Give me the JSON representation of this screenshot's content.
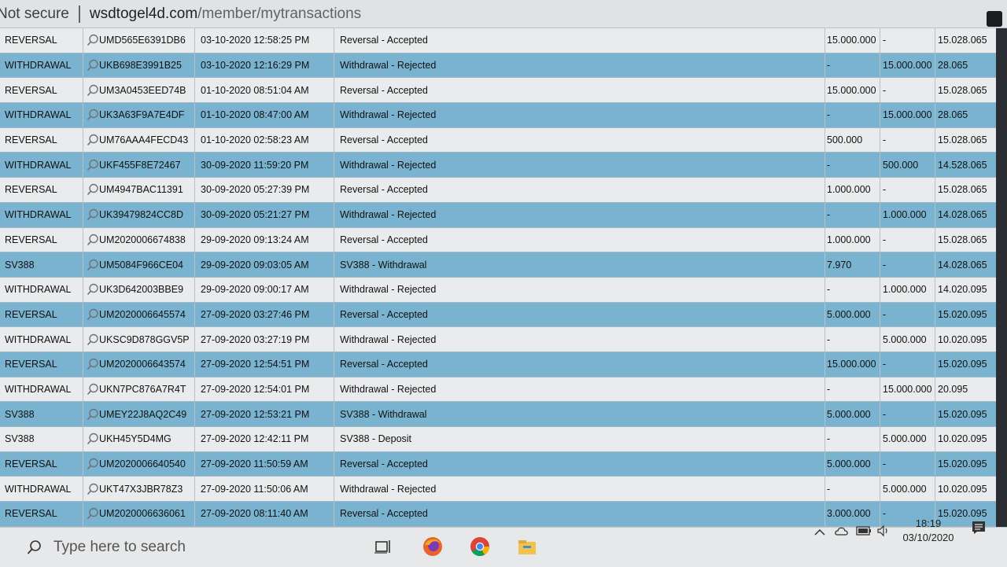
{
  "address_bar": {
    "security_label": "Not secure",
    "url_host": "wsdtogel4d.com",
    "url_path": "/member/mytransactions"
  },
  "transactions": [
    {
      "type": "REVERSAL",
      "id": "UMD565E6391DB6",
      "date": "03-10-2020 12:58:25 PM",
      "desc": "Reversal - Accepted",
      "debit": "15.000.000",
      "credit": "-",
      "balance": "15.028.065"
    },
    {
      "type": "WITHDRAWAL",
      "id": "UKB698E3991B25",
      "date": "03-10-2020 12:16:29 PM",
      "desc": "Withdrawal - Rejected",
      "debit": "-",
      "credit": "15.000.000",
      "balance": "28.065"
    },
    {
      "type": "REVERSAL",
      "id": "UM3A0453EED74B",
      "date": "01-10-2020 08:51:04 AM",
      "desc": "Reversal - Accepted",
      "debit": "15.000.000",
      "credit": "-",
      "balance": "15.028.065"
    },
    {
      "type": "WITHDRAWAL",
      "id": "UK3A63F9A7E4DF",
      "date": "01-10-2020 08:47:00 AM",
      "desc": "Withdrawal - Rejected",
      "debit": "-",
      "credit": "15.000.000",
      "balance": "28.065"
    },
    {
      "type": "REVERSAL",
      "id": "UM76AAA4FECD43",
      "date": "01-10-2020 02:58:23 AM",
      "desc": "Reversal - Accepted",
      "debit": "500.000",
      "credit": "-",
      "balance": "15.028.065"
    },
    {
      "type": "WITHDRAWAL",
      "id": "UKF455F8E72467",
      "date": "30-09-2020 11:59:20 PM",
      "desc": "Withdrawal - Rejected",
      "debit": "-",
      "credit": "500.000",
      "balance": "14.528.065"
    },
    {
      "type": "REVERSAL",
      "id": "UM4947BAC11391",
      "date": "30-09-2020 05:27:39 PM",
      "desc": "Reversal - Accepted",
      "debit": "1.000.000",
      "credit": "-",
      "balance": "15.028.065"
    },
    {
      "type": "WITHDRAWAL",
      "id": "UK39479824CC8D",
      "date": "30-09-2020 05:21:27 PM",
      "desc": "Withdrawal - Rejected",
      "debit": "-",
      "credit": "1.000.000",
      "balance": "14.028.065"
    },
    {
      "type": "REVERSAL",
      "id": "UM2020006674838",
      "date": "29-09-2020 09:13:24 AM",
      "desc": "Reversal - Accepted",
      "debit": "1.000.000",
      "credit": "-",
      "balance": "15.028.065"
    },
    {
      "type": "SV388",
      "id": "UM5084F966CE04",
      "date": "29-09-2020 09:03:05 AM",
      "desc": "SV388 - Withdrawal",
      "debit": "7.970",
      "credit": "-",
      "balance": "14.028.065"
    },
    {
      "type": "WITHDRAWAL",
      "id": "UK3D642003BBE9",
      "date": "29-09-2020 09:00:17 AM",
      "desc": "Withdrawal - Rejected",
      "debit": "-",
      "credit": "1.000.000",
      "balance": "14.020.095"
    },
    {
      "type": "REVERSAL",
      "id": "UM2020006645574",
      "date": "27-09-2020 03:27:46 PM",
      "desc": "Reversal - Accepted",
      "debit": "5.000.000",
      "credit": "-",
      "balance": "15.020.095"
    },
    {
      "type": "WITHDRAWAL",
      "id": "UKSC9D878GGV5P",
      "date": "27-09-2020 03:27:19 PM",
      "desc": "Withdrawal - Rejected",
      "debit": "-",
      "credit": "5.000.000",
      "balance": "10.020.095"
    },
    {
      "type": "REVERSAL",
      "id": "UM2020006643574",
      "date": "27-09-2020 12:54:51 PM",
      "desc": "Reversal - Accepted",
      "debit": "15.000.000",
      "credit": "-",
      "balance": "15.020.095"
    },
    {
      "type": "WITHDRAWAL",
      "id": "UKN7PC876A7R4T",
      "date": "27-09-2020 12:54:01 PM",
      "desc": "Withdrawal - Rejected",
      "debit": "-",
      "credit": "15.000.000",
      "balance": "20.095"
    },
    {
      "type": "SV388",
      "id": "UMEY22J8AQ2C49",
      "date": "27-09-2020 12:53:21 PM",
      "desc": "SV388 - Withdrawal",
      "debit": "5.000.000",
      "credit": "-",
      "balance": "15.020.095"
    },
    {
      "type": "SV388",
      "id": "UKH45Y5D4MG",
      "date": "27-09-2020 12:42:11 PM",
      "desc": "SV388 - Deposit",
      "debit": "-",
      "credit": "5.000.000",
      "balance": "10.020.095"
    },
    {
      "type": "REVERSAL",
      "id": "UM2020006640540",
      "date": "27-09-2020 11:50:59 AM",
      "desc": "Reversal - Accepted",
      "debit": "5.000.000",
      "credit": "-",
      "balance": "15.020.095"
    },
    {
      "type": "WITHDRAWAL",
      "id": "UKT47X3JBR78Z3",
      "date": "27-09-2020 11:50:06 AM",
      "desc": "Withdrawal - Rejected",
      "debit": "-",
      "credit": "5.000.000",
      "balance": "10.020.095"
    },
    {
      "type": "REVERSAL",
      "id": "UM2020006636061",
      "date": "27-09-2020 08:11:40 AM",
      "desc": "Reversal - Accepted",
      "debit": "3.000.000",
      "credit": "-",
      "balance": "15.020.095"
    }
  ],
  "taskbar": {
    "search_placeholder": "Type here to search",
    "time": "18:19",
    "date": "03/10/2020"
  },
  "colors": {
    "row_light": "#e9ebec",
    "row_blue": "#79b3cf"
  }
}
